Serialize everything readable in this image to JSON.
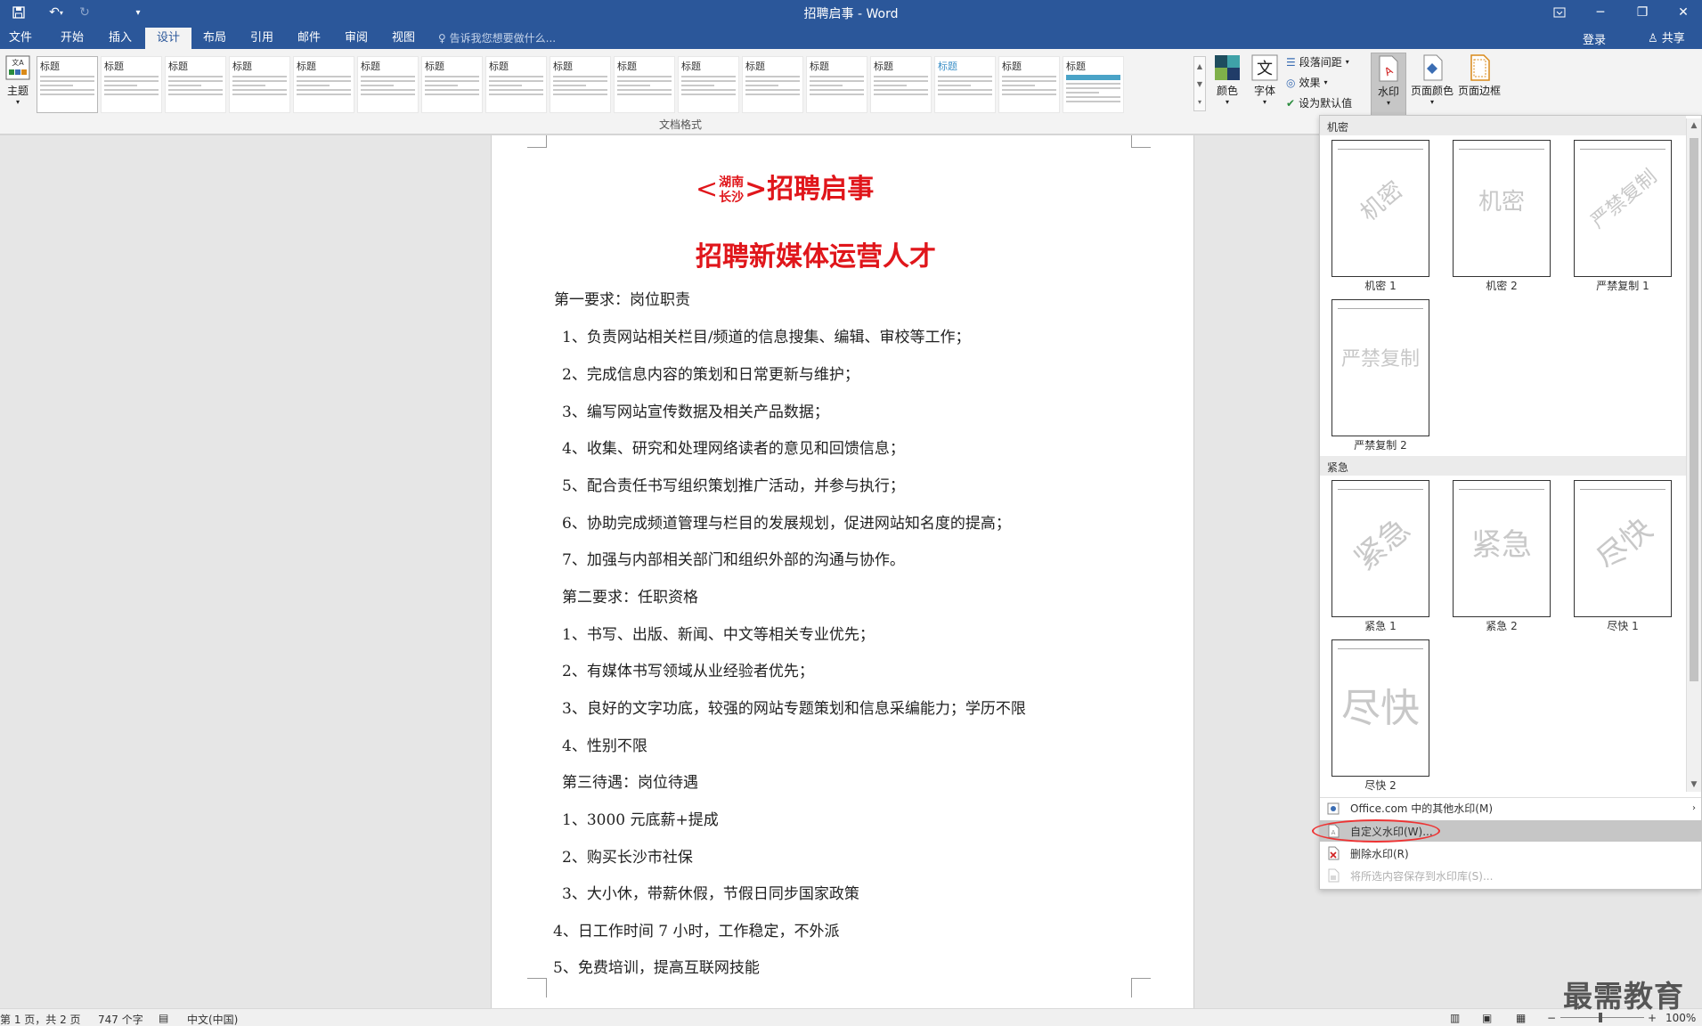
{
  "window": {
    "title": "招聘启事 - Word"
  },
  "tabs": [
    "文件",
    "开始",
    "插入",
    "设计",
    "布局",
    "引用",
    "邮件",
    "审阅",
    "视图"
  ],
  "tell_me": "告诉我您想要做什么...",
  "account": {
    "login": "登录",
    "share": "共享"
  },
  "ribbon": {
    "theme": "主题",
    "style_heading": "标题",
    "group_label": "文档格式",
    "colors": "颜色",
    "fonts": "字体",
    "paragraph_spacing": "段落间距",
    "effects": "效果",
    "set_default": "设为默认值",
    "watermark": "水印",
    "page_color": "页面颜色",
    "page_borders": "页面边框"
  },
  "document": {
    "heading_prefix": "<",
    "heading_stack_top": "湖南",
    "heading_stack_bottom": "长沙",
    "heading_suffix": ">招聘启事",
    "subheading": "招聘新媒体运营人才",
    "lines": [
      "第一要求：岗位职责",
      "1、负责网站相关栏目/频道的信息搜集、编辑、审校等工作；",
      "2、完成信息内容的策划和日常更新与维护；",
      "3、编写网站宣传数据及相关产品数据；",
      "4、收集、研究和处理网络读者的意见和回馈信息；",
      "5、配合责任书写组织策划推广活动，并参与执行；",
      "6、协助完成频道管理与栏目的发展规划，促进网站知名度的提高；",
      "7、加强与内部相关部门和组织外部的沟通与协作。",
      "第二要求：任职资格",
      "1、书写、出版、新闻、中文等相关专业优先；",
      "2、有媒体书写领域从业经验者优先；",
      "3、良好的文字功底，较强的网站专题策划和信息采编能力；学历不限",
      "4、性别不限",
      "第三待遇：岗位待遇",
      "1、3000 元底薪+提成",
      "2、购买长沙市社保",
      "3、大小休，带薪休假，节假日同步国家政策",
      "4、日工作时间 7 小时，工作稳定，不外派",
      "5、免费培训，提高互联网技能"
    ]
  },
  "watermark_panel": {
    "section1": "机密",
    "section2": "紧急",
    "items": [
      {
        "text": "机密",
        "caption": "机密 1"
      },
      {
        "text": "机密",
        "caption": "机密 2"
      },
      {
        "text": "严禁复制",
        "caption": "严禁复制 1"
      },
      {
        "text": "严禁复制",
        "caption": "严禁复制 2"
      },
      {
        "text": "紧急",
        "caption": "紧急 1"
      },
      {
        "text": "紧急",
        "caption": "紧急 2"
      },
      {
        "text": "尽快",
        "caption": "尽快 1"
      },
      {
        "text": "尽快",
        "caption": "尽快 2"
      }
    ],
    "menu": [
      "Office.com 中的其他水印(M)",
      "自定义水印(W)...",
      "删除水印(R)",
      "将所选内容保存到水印库(S)..."
    ]
  },
  "status": {
    "page": "第 1 页，共 2 页",
    "words": "747 个字",
    "language": "中文(中国)",
    "zoom": "100%"
  },
  "brand": "最需教育",
  "colors": {
    "accent": "#2b579a",
    "heading_red": "#e0161b"
  }
}
